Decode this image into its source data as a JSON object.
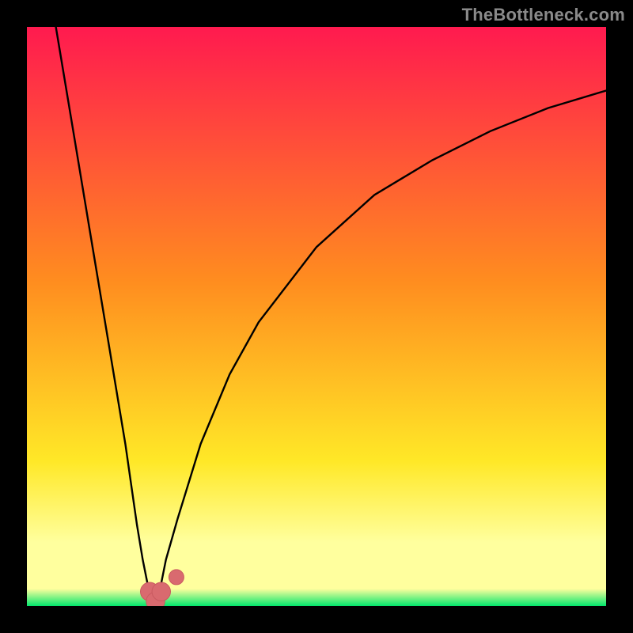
{
  "attribution": "TheBottleneck.com",
  "colors": {
    "frame": "#000000",
    "grad_top": "#ff1a4f",
    "grad_mid1": "#ff8d1f",
    "grad_mid2": "#ffe827",
    "grad_pale": "#ffff9e",
    "grad_bottom": "#00e66b",
    "curve": "#000000",
    "marker_fill": "#d96a6f",
    "marker_stroke": "#c95a60"
  },
  "chart_data": {
    "type": "line",
    "title": "",
    "xlabel": "",
    "ylabel": "",
    "xlim": [
      0,
      100
    ],
    "ylim": [
      0,
      100
    ],
    "note": "Bottleneck-style curve. x is a normalized component-ratio axis (0–100); y is bottleneck percentage (0 = no bottleneck at top of green, 100 = maximum bottleneck at top of red). Minimum near x≈22.",
    "series": [
      {
        "name": "bottleneck-curve",
        "x": [
          5,
          8,
          11,
          14,
          17,
          19,
          20,
          21,
          22,
          23,
          24,
          26,
          30,
          35,
          40,
          50,
          60,
          70,
          80,
          90,
          100
        ],
        "values": [
          100,
          82,
          64,
          46,
          28,
          14,
          8,
          3,
          0,
          3,
          8,
          15,
          28,
          40,
          49,
          62,
          71,
          77,
          82,
          86,
          89
        ]
      }
    ],
    "markers": [
      {
        "name": "left-lobe",
        "x": 21.2,
        "y": 2.5,
        "r_pct": 1.6
      },
      {
        "name": "valley",
        "x": 22.2,
        "y": 0.8,
        "r_pct": 1.6
      },
      {
        "name": "right-lobe",
        "x": 23.2,
        "y": 2.5,
        "r_pct": 1.6
      },
      {
        "name": "right-dot",
        "x": 25.8,
        "y": 5.0,
        "r_pct": 1.3
      }
    ],
    "gradient_stops": [
      {
        "pct": 0,
        "color_key": "grad_top"
      },
      {
        "pct": 44,
        "color_key": "grad_mid1"
      },
      {
        "pct": 75,
        "color_key": "grad_mid2"
      },
      {
        "pct": 89,
        "color_key": "grad_pale"
      },
      {
        "pct": 97,
        "color_key": "grad_pale"
      },
      {
        "pct": 100,
        "color_key": "grad_bottom"
      }
    ]
  }
}
